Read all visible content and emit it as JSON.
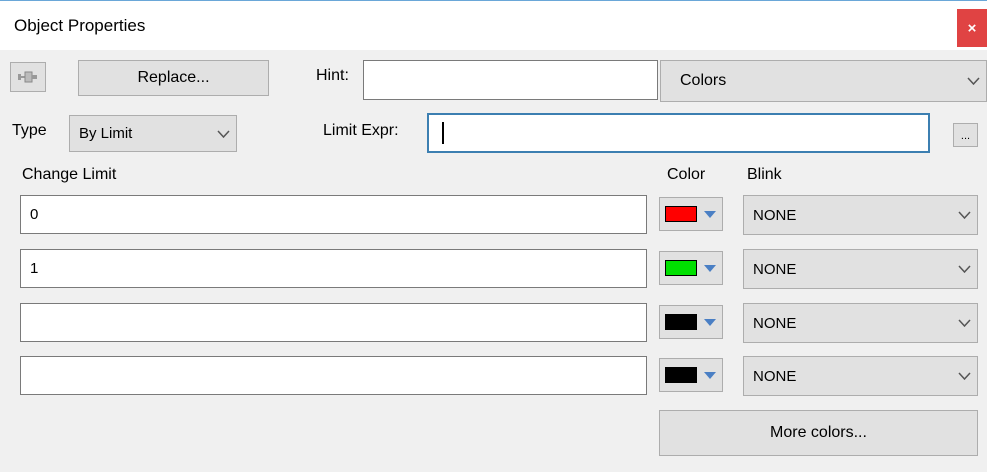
{
  "window": {
    "title": "Object Properties",
    "close_glyph": "×"
  },
  "toolbar": {
    "pin_icon": "pushpin-icon",
    "replace_label": "Replace...",
    "hint_label": "Hint:",
    "hint_value": "",
    "category_value": "Colors"
  },
  "type_row": {
    "type_label": "Type",
    "type_value": "By Limit",
    "limit_expr_label": "Limit Expr:",
    "limit_expr_value": "",
    "ellipsis_label": "..."
  },
  "headers": {
    "change_limit": "Change Limit",
    "color": "Color",
    "blink": "Blink"
  },
  "rows": [
    {
      "limit": "0",
      "color": "#ff0000",
      "blink": "NONE"
    },
    {
      "limit": "1",
      "color": "#00e000",
      "blink": "NONE"
    },
    {
      "limit": "",
      "color": "#000000",
      "blink": "NONE"
    },
    {
      "limit": "",
      "color": "#000000",
      "blink": "NONE"
    }
  ],
  "more_colors_label": "More colors...",
  "colors": {
    "accent_border": "#3c7fb1",
    "close_bg": "#e04343"
  }
}
